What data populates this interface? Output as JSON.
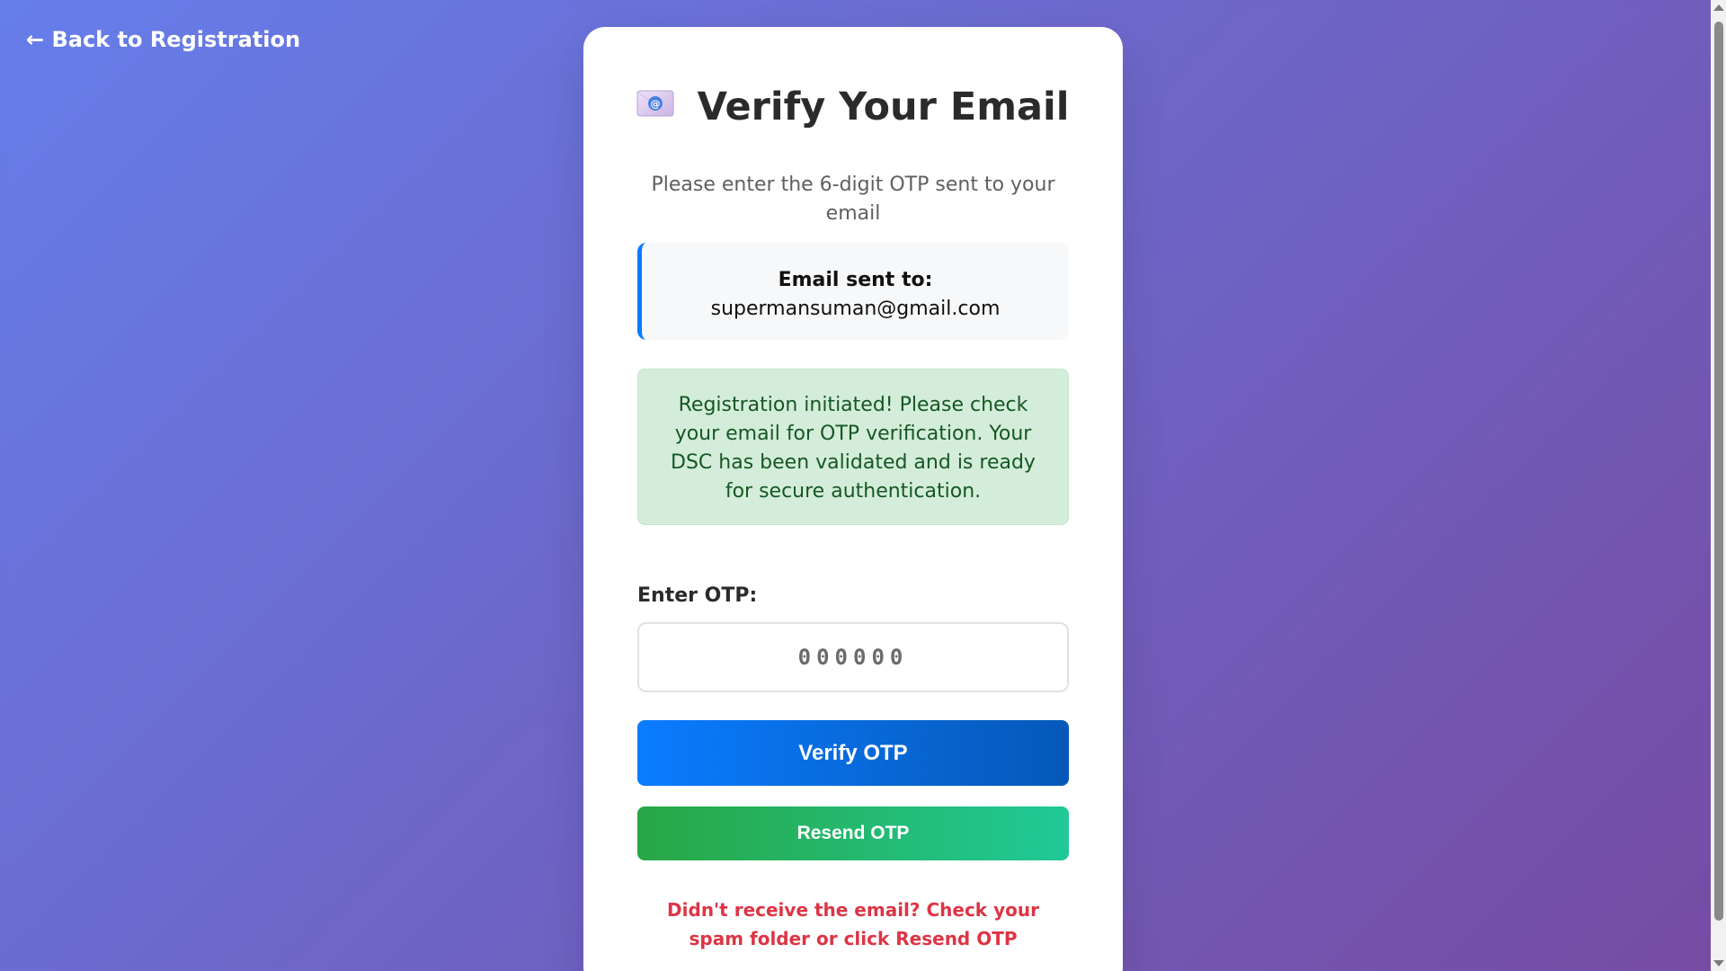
{
  "nav": {
    "back_label": "← Back to Registration"
  },
  "card": {
    "icon": "envelope-icon",
    "title": "Verify Your Email",
    "subtitle": "Please enter the 6-digit OTP sent to your email",
    "email_box": {
      "label": "Email sent to:",
      "address": "supermansuman@gmail.com"
    },
    "alert": {
      "message": "Registration initiated! Please check your email for OTP verification. Your DSC has been validated and is ready for secure authentication."
    },
    "otp": {
      "label": "Enter OTP:",
      "placeholder": "000000",
      "value": ""
    },
    "buttons": {
      "verify_label": "Verify OTP",
      "resend_label": "Resend OTP"
    },
    "hint": "Didn't receive the email? Check your spam folder or click Resend OTP"
  },
  "colors": {
    "background_start": "#667eea",
    "background_end": "#764ba2",
    "accent": "#0a7cff",
    "success": "#28a745",
    "alert_bg": "#d4edda",
    "alert_text": "#155724",
    "hint": "#dc3545"
  }
}
